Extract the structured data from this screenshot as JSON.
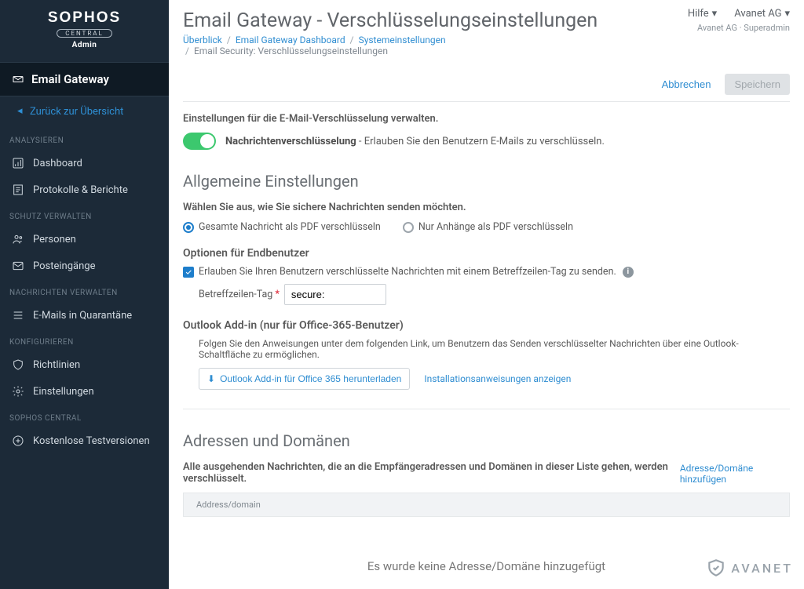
{
  "brand": {
    "name": "SOPHOS",
    "variant": "CENTRAL",
    "role": "Admin"
  },
  "sidebar": {
    "current_app": "Email Gateway",
    "back": "Zurück zur Übersicht",
    "groups": [
      {
        "label": "ANALYSIEREN",
        "items": [
          {
            "label": "Dashboard",
            "icon": "dashboard-icon"
          },
          {
            "label": "Protokolle & Berichte",
            "icon": "report-icon"
          }
        ]
      },
      {
        "label": "SCHUTZ VERWALTEN",
        "items": [
          {
            "label": "Personen",
            "icon": "people-icon"
          },
          {
            "label": "Posteingänge",
            "icon": "inbox-icon"
          }
        ]
      },
      {
        "label": "NACHRICHTEN VERWALTEN",
        "items": [
          {
            "label": "E-Mails in Quarantäne",
            "icon": "quarantine-icon"
          }
        ]
      },
      {
        "label": "KONFIGURIEREN",
        "items": [
          {
            "label": "Richtlinien",
            "icon": "policy-icon"
          },
          {
            "label": "Einstellungen",
            "icon": "settings-icon"
          }
        ]
      },
      {
        "label": "SOPHOS CENTRAL",
        "items": [
          {
            "label": "Kostenlose Testversionen",
            "icon": "trial-icon"
          }
        ]
      }
    ]
  },
  "header": {
    "title": "Email Gateway - Verschlüsselungseinstellungen",
    "crumbs": [
      "Überblick",
      "Email Gateway Dashboard",
      "Systemeinstellungen",
      "Email Security: Verschlüsselungseinstellungen"
    ],
    "help": "Hilfe",
    "tenant": "Avanet AG",
    "subinfo": "Avanet AG · Superadmin"
  },
  "actions": {
    "cancel": "Abbrechen",
    "save": "Speichern"
  },
  "settings": {
    "intro": "Einstellungen für die E-Mail-Verschlüsselung verwalten.",
    "toggle_bold": "Nachrichtenverschlüsselung",
    "toggle_rest": " - Erlauben Sie den Benutzern E-Mails zu verschlüsseln.",
    "toggle_on": true,
    "general_title": "Allgemeine Einstellungen",
    "radio_prompt": "Wählen Sie aus, wie Sie sichere Nachrichten senden möchten.",
    "radio_full": "Gesamte Nachricht als PDF verschlüsseln",
    "radio_att": "Nur Anhänge als PDF verschlüsseln",
    "radio_selected": "full",
    "enduser_title": "Optionen für Endbenutzer",
    "enduser_check": "Erlauben Sie Ihren Benutzern verschlüsselte Nachrichten mit einem Betreffzeilen-Tag zu senden.",
    "tag_label": "Betreffzeilen-Tag",
    "tag_value": "secure:",
    "outlook_title": "Outlook Add-in (nur für Office-365-Benutzer)",
    "outlook_text": "Folgen Sie den Anweisungen unter dem folgenden Link, um Benutzern das Senden verschlüsselter Nachrichten über eine Outlook-Schaltfläche zu ermöglichen.",
    "outlook_dl": "Outlook Add-in für Office 365 herunterladen",
    "outlook_instr": "Installationsanweisungen anzeigen",
    "domains_title": "Adressen und Domänen",
    "domains_intro": "Alle ausgehenden Nachrichten, die an die Empfängeradressen und Domänen in dieser Liste gehen, werden verschlüsselt.",
    "domains_add": "Adresse/Domäne hinzufügen",
    "domains_col": "Address/domain",
    "domains_empty": "Es wurde keine Adresse/Domäne hinzugefügt"
  },
  "watermark": "AVANET"
}
